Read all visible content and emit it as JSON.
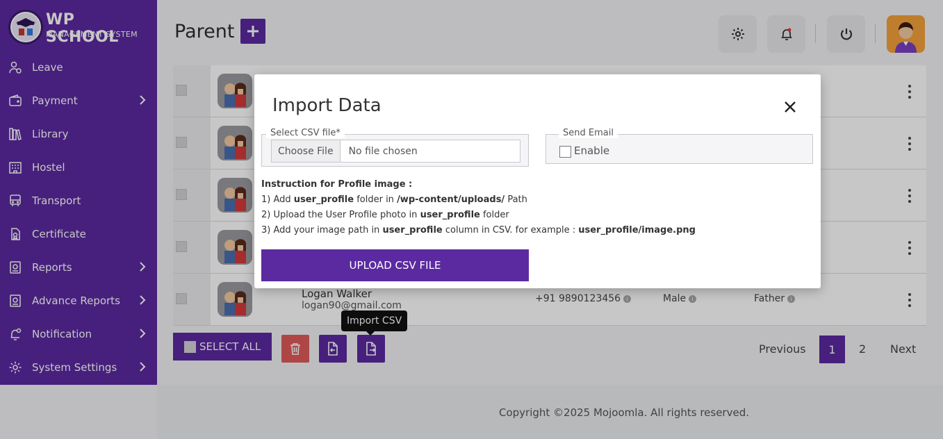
{
  "brand": {
    "title": "WP SCHOOL",
    "subtitle": "MANAGEMENT SYSTEM"
  },
  "sidebar": {
    "items": [
      {
        "label": "Leave",
        "icon": "leave-icon",
        "has_chevron": false
      },
      {
        "label": "Payment",
        "icon": "wallet-icon",
        "has_chevron": true
      },
      {
        "label": "Library",
        "icon": "library-icon",
        "has_chevron": false
      },
      {
        "label": "Hostel",
        "icon": "hostel-icon",
        "has_chevron": false
      },
      {
        "label": "Transport",
        "icon": "bus-icon",
        "has_chevron": false
      },
      {
        "label": "Certificate",
        "icon": "certificate-icon",
        "has_chevron": false
      },
      {
        "label": "Reports",
        "icon": "reports-icon",
        "has_chevron": true
      },
      {
        "label": "Advance Reports",
        "icon": "advance-reports-icon",
        "has_chevron": true
      },
      {
        "label": "Notification",
        "icon": "bell-icon",
        "has_chevron": true
      },
      {
        "label": "System Settings",
        "icon": "gear-icon",
        "has_chevron": true
      }
    ]
  },
  "header": {
    "title": "Parent"
  },
  "table": {
    "visible_row": {
      "name": "Logan Walker",
      "email": "logan90@gmail.com",
      "phone": "+91 9890123456",
      "gender": "Male",
      "relation": "Father"
    },
    "row_count": 5
  },
  "actions": {
    "select_all": "SELECT ALL",
    "tooltip": "Import CSV"
  },
  "pagination": {
    "previous": "Previous",
    "page1": "1",
    "page2": "2",
    "next": "Next"
  },
  "footer": {
    "copyright": "Copyright ©2025 Mojoomla. All rights reserved."
  },
  "modal": {
    "title": "Import Data",
    "csv_legend": "Select CSV file*",
    "choose_file": "Choose File",
    "no_file": "No file chosen",
    "email_legend": "Send Email",
    "enable_label": "Enable",
    "instructions_title": "Instruction for Profile image :",
    "line1": {
      "a": "1) Add ",
      "b": "user_profile",
      "c": " folder in ",
      "d": "/wp-content/uploads/",
      "e": " Path"
    },
    "line2": {
      "a": "2) Upload the User Profile photo in ",
      "b": "user_profile",
      "c": " folder"
    },
    "line3": {
      "a": "3) Add your image path in ",
      "b": "user_profile",
      "c": " column in CSV. for example : ",
      "d": "user_profile/image.png"
    },
    "upload_button": "UPLOAD CSV FILE"
  },
  "colors": {
    "primary": "#5b2aa0",
    "danger": "#e05a5a"
  }
}
